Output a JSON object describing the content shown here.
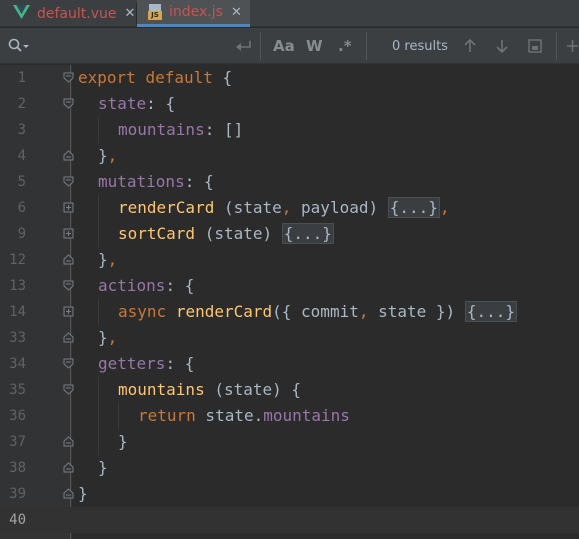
{
  "tabs": [
    {
      "label": "default.vue",
      "icon": "vue-icon",
      "close": "✕",
      "active": false
    },
    {
      "label": "index.js",
      "icon": "js-file-icon",
      "close": "✕",
      "active": true
    }
  ],
  "search": {
    "icon": "search-icon",
    "case_label": "Aa",
    "word_label": "W",
    "regex_label": ".*",
    "results_text": "0 results"
  },
  "colors": {
    "background": "#2b2b2b",
    "keyword": "#cc7832",
    "property": "#9876aa",
    "function": "#ffc66d",
    "text": "#a9b7c6",
    "tab_label": "#c75450",
    "line_number": "#606366"
  },
  "lines": [
    {
      "num": "1",
      "indent": 0,
      "tokens": [
        [
          "kw",
          "export"
        ],
        [
          "txt",
          " "
        ],
        [
          "kw",
          "default"
        ],
        [
          "txt",
          " {"
        ]
      ]
    },
    {
      "num": "2",
      "indent": 1,
      "tokens": [
        [
          "prop",
          "state"
        ],
        [
          "txt",
          ": {"
        ]
      ]
    },
    {
      "num": "3",
      "indent": 2,
      "tokens": [
        [
          "prop",
          "mountains"
        ],
        [
          "txt",
          ": []"
        ]
      ]
    },
    {
      "num": "4",
      "indent": 1,
      "tokens": [
        [
          "txt",
          "}"
        ],
        [
          "kw",
          ","
        ]
      ]
    },
    {
      "num": "5",
      "indent": 1,
      "tokens": [
        [
          "prop",
          "mutations"
        ],
        [
          "txt",
          ": {"
        ]
      ]
    },
    {
      "num": "6",
      "indent": 2,
      "tokens": [
        [
          "fn",
          "renderCard"
        ],
        [
          "txt",
          " (state"
        ],
        [
          "kw",
          ","
        ],
        [
          "txt",
          " payload) "
        ],
        [
          "fold",
          "{...}"
        ],
        [
          "kw",
          ","
        ]
      ]
    },
    {
      "num": "9",
      "indent": 2,
      "tokens": [
        [
          "fn",
          "sortCard"
        ],
        [
          "txt",
          " (state) "
        ],
        [
          "fold",
          "{...}"
        ]
      ]
    },
    {
      "num": "12",
      "indent": 1,
      "tokens": [
        [
          "txt",
          "}"
        ],
        [
          "kw",
          ","
        ]
      ]
    },
    {
      "num": "13",
      "indent": 1,
      "tokens": [
        [
          "prop",
          "actions"
        ],
        [
          "txt",
          ": {"
        ]
      ]
    },
    {
      "num": "14",
      "indent": 2,
      "tokens": [
        [
          "kw",
          "async"
        ],
        [
          "txt",
          " "
        ],
        [
          "fn",
          "renderCard"
        ],
        [
          "txt",
          "({ commit"
        ],
        [
          "kw",
          ","
        ],
        [
          "txt",
          " state }) "
        ],
        [
          "fold",
          "{...}"
        ]
      ]
    },
    {
      "num": "33",
      "indent": 1,
      "tokens": [
        [
          "txt",
          "}"
        ],
        [
          "kw",
          ","
        ]
      ]
    },
    {
      "num": "34",
      "indent": 1,
      "tokens": [
        [
          "prop",
          "getters"
        ],
        [
          "txt",
          ": {"
        ]
      ]
    },
    {
      "num": "35",
      "indent": 2,
      "tokens": [
        [
          "fn",
          "mountains"
        ],
        [
          "txt",
          " (state) {"
        ]
      ]
    },
    {
      "num": "36",
      "indent": 3,
      "tokens": [
        [
          "kw",
          "return"
        ],
        [
          "txt",
          " state."
        ],
        [
          "prop",
          "mountains"
        ]
      ]
    },
    {
      "num": "37",
      "indent": 2,
      "tokens": [
        [
          "txt",
          "}"
        ]
      ]
    },
    {
      "num": "38",
      "indent": 1,
      "tokens": [
        [
          "txt",
          "}"
        ]
      ]
    },
    {
      "num": "39",
      "indent": 0,
      "tokens": [
        [
          "txt",
          "}"
        ]
      ]
    },
    {
      "num": "40",
      "indent": 0,
      "tokens": []
    }
  ],
  "fold_markers": [
    "open",
    "open",
    "none",
    "close",
    "open",
    "collapsed",
    "collapsed",
    "close",
    "open",
    "collapsed",
    "close",
    "open",
    "open",
    "none",
    "close",
    "close",
    "close",
    "none"
  ],
  "current_line": "40"
}
